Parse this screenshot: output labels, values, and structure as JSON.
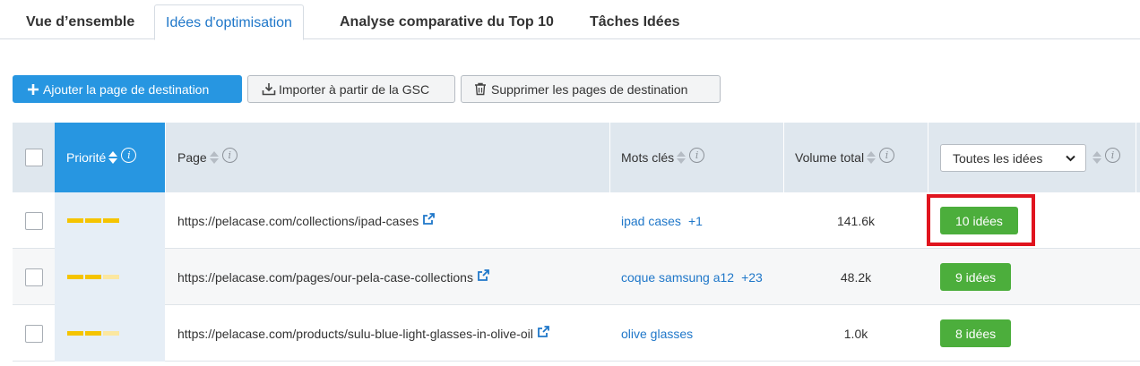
{
  "tabs": [
    {
      "label": "Vue d’ensemble",
      "active": false
    },
    {
      "label": "Idées d'optimisation",
      "active": true
    },
    {
      "label": "Analyse comparative du Top 10",
      "active": false
    },
    {
      "label": "Tâches Idées",
      "active": false
    }
  ],
  "toolbar": {
    "add_label": "Ajouter la page de destination",
    "import_label": "Importer à partir de la GSC",
    "delete_label": "Supprimer les pages de destination"
  },
  "table": {
    "headers": {
      "priority": "Priorité",
      "page": "Page",
      "keywords": "Mots clés",
      "volume": "Volume total",
      "ideas_filter": "Toutes les idées"
    },
    "rows": [
      {
        "priority": 3,
        "page": "https://pelacase.com/collections/ipad-cases",
        "keyword": "ipad cases",
        "keyword_extra": "+1",
        "volume": "141.6k",
        "ideas": "10 idées",
        "highlighted": true
      },
      {
        "priority": 2,
        "page": "https://pelacase.com/pages/our-pela-case-collections",
        "keyword": "coque samsung a12",
        "keyword_extra": "+23",
        "volume": "48.2k",
        "ideas": "9 idées",
        "highlighted": false
      },
      {
        "priority": 2,
        "page": "https://pelacase.com/products/sulu-blue-light-glasses-in-olive-oil",
        "keyword": "olive glasses",
        "keyword_extra": "",
        "volume": "1.0k",
        "ideas": "8 idées",
        "highlighted": false
      }
    ]
  },
  "colors": {
    "primary": "#2796e1",
    "link": "#1f77c9",
    "ideas_green": "#4cae3c",
    "priority_yellow": "#f5c400",
    "highlight_red": "#e0141e",
    "header_bg": "#dfe7ee"
  }
}
